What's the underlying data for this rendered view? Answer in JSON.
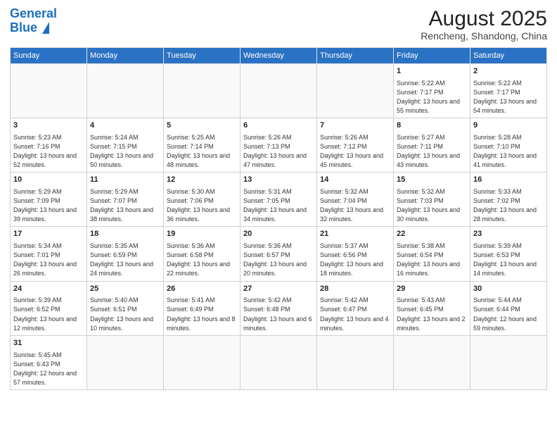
{
  "logo": {
    "text_general": "General",
    "text_blue": "Blue"
  },
  "header": {
    "month_year": "August 2025",
    "location": "Rencheng, Shandong, China"
  },
  "days_of_week": [
    "Sunday",
    "Monday",
    "Tuesday",
    "Wednesday",
    "Thursday",
    "Friday",
    "Saturday"
  ],
  "weeks": [
    [
      {
        "day": "",
        "empty": true
      },
      {
        "day": "",
        "empty": true
      },
      {
        "day": "",
        "empty": true
      },
      {
        "day": "",
        "empty": true
      },
      {
        "day": "",
        "empty": true
      },
      {
        "day": "1",
        "sunrise": "Sunrise: 5:22 AM",
        "sunset": "Sunset: 7:17 PM",
        "daylight": "Daylight: 13 hours and 55 minutes."
      },
      {
        "day": "2",
        "sunrise": "Sunrise: 5:22 AM",
        "sunset": "Sunset: 7:17 PM",
        "daylight": "Daylight: 13 hours and 54 minutes."
      }
    ],
    [
      {
        "day": "3",
        "sunrise": "Sunrise: 5:23 AM",
        "sunset": "Sunset: 7:16 PM",
        "daylight": "Daylight: 13 hours and 52 minutes."
      },
      {
        "day": "4",
        "sunrise": "Sunrise: 5:24 AM",
        "sunset": "Sunset: 7:15 PM",
        "daylight": "Daylight: 13 hours and 50 minutes."
      },
      {
        "day": "5",
        "sunrise": "Sunrise: 5:25 AM",
        "sunset": "Sunset: 7:14 PM",
        "daylight": "Daylight: 13 hours and 48 minutes."
      },
      {
        "day": "6",
        "sunrise": "Sunrise: 5:26 AM",
        "sunset": "Sunset: 7:13 PM",
        "daylight": "Daylight: 13 hours and 47 minutes."
      },
      {
        "day": "7",
        "sunrise": "Sunrise: 5:26 AM",
        "sunset": "Sunset: 7:12 PM",
        "daylight": "Daylight: 13 hours and 45 minutes."
      },
      {
        "day": "8",
        "sunrise": "Sunrise: 5:27 AM",
        "sunset": "Sunset: 7:11 PM",
        "daylight": "Daylight: 13 hours and 43 minutes."
      },
      {
        "day": "9",
        "sunrise": "Sunrise: 5:28 AM",
        "sunset": "Sunset: 7:10 PM",
        "daylight": "Daylight: 13 hours and 41 minutes."
      }
    ],
    [
      {
        "day": "10",
        "sunrise": "Sunrise: 5:29 AM",
        "sunset": "Sunset: 7:09 PM",
        "daylight": "Daylight: 13 hours and 39 minutes."
      },
      {
        "day": "11",
        "sunrise": "Sunrise: 5:29 AM",
        "sunset": "Sunset: 7:07 PM",
        "daylight": "Daylight: 13 hours and 38 minutes."
      },
      {
        "day": "12",
        "sunrise": "Sunrise: 5:30 AM",
        "sunset": "Sunset: 7:06 PM",
        "daylight": "Daylight: 13 hours and 36 minutes."
      },
      {
        "day": "13",
        "sunrise": "Sunrise: 5:31 AM",
        "sunset": "Sunset: 7:05 PM",
        "daylight": "Daylight: 13 hours and 34 minutes."
      },
      {
        "day": "14",
        "sunrise": "Sunrise: 5:32 AM",
        "sunset": "Sunset: 7:04 PM",
        "daylight": "Daylight: 13 hours and 32 minutes."
      },
      {
        "day": "15",
        "sunrise": "Sunrise: 5:32 AM",
        "sunset": "Sunset: 7:03 PM",
        "daylight": "Daylight: 13 hours and 30 minutes."
      },
      {
        "day": "16",
        "sunrise": "Sunrise: 5:33 AM",
        "sunset": "Sunset: 7:02 PM",
        "daylight": "Daylight: 13 hours and 28 minutes."
      }
    ],
    [
      {
        "day": "17",
        "sunrise": "Sunrise: 5:34 AM",
        "sunset": "Sunset: 7:01 PM",
        "daylight": "Daylight: 13 hours and 26 minutes."
      },
      {
        "day": "18",
        "sunrise": "Sunrise: 5:35 AM",
        "sunset": "Sunset: 6:59 PM",
        "daylight": "Daylight: 13 hours and 24 minutes."
      },
      {
        "day": "19",
        "sunrise": "Sunrise: 5:36 AM",
        "sunset": "Sunset: 6:58 PM",
        "daylight": "Daylight: 13 hours and 22 minutes."
      },
      {
        "day": "20",
        "sunrise": "Sunrise: 5:36 AM",
        "sunset": "Sunset: 6:57 PM",
        "daylight": "Daylight: 13 hours and 20 minutes."
      },
      {
        "day": "21",
        "sunrise": "Sunrise: 5:37 AM",
        "sunset": "Sunset: 6:56 PM",
        "daylight": "Daylight: 13 hours and 18 minutes."
      },
      {
        "day": "22",
        "sunrise": "Sunrise: 5:38 AM",
        "sunset": "Sunset: 6:54 PM",
        "daylight": "Daylight: 13 hours and 16 minutes."
      },
      {
        "day": "23",
        "sunrise": "Sunrise: 5:39 AM",
        "sunset": "Sunset: 6:53 PM",
        "daylight": "Daylight: 13 hours and 14 minutes."
      }
    ],
    [
      {
        "day": "24",
        "sunrise": "Sunrise: 5:39 AM",
        "sunset": "Sunset: 6:52 PM",
        "daylight": "Daylight: 13 hours and 12 minutes."
      },
      {
        "day": "25",
        "sunrise": "Sunrise: 5:40 AM",
        "sunset": "Sunset: 6:51 PM",
        "daylight": "Daylight: 13 hours and 10 minutes."
      },
      {
        "day": "26",
        "sunrise": "Sunrise: 5:41 AM",
        "sunset": "Sunset: 6:49 PM",
        "daylight": "Daylight: 13 hours and 8 minutes."
      },
      {
        "day": "27",
        "sunrise": "Sunrise: 5:42 AM",
        "sunset": "Sunset: 6:48 PM",
        "daylight": "Daylight: 13 hours and 6 minutes."
      },
      {
        "day": "28",
        "sunrise": "Sunrise: 5:42 AM",
        "sunset": "Sunset: 6:47 PM",
        "daylight": "Daylight: 13 hours and 4 minutes."
      },
      {
        "day": "29",
        "sunrise": "Sunrise: 5:43 AM",
        "sunset": "Sunset: 6:45 PM",
        "daylight": "Daylight: 13 hours and 2 minutes."
      },
      {
        "day": "30",
        "sunrise": "Sunrise: 5:44 AM",
        "sunset": "Sunset: 6:44 PM",
        "daylight": "Daylight: 12 hours and 59 minutes."
      }
    ],
    [
      {
        "day": "31",
        "sunrise": "Sunrise: 5:45 AM",
        "sunset": "Sunset: 6:43 PM",
        "daylight": "Daylight: 12 hours and 57 minutes."
      },
      {
        "day": "",
        "empty": true
      },
      {
        "day": "",
        "empty": true
      },
      {
        "day": "",
        "empty": true
      },
      {
        "day": "",
        "empty": true
      },
      {
        "day": "",
        "empty": true
      },
      {
        "day": "",
        "empty": true
      }
    ]
  ]
}
